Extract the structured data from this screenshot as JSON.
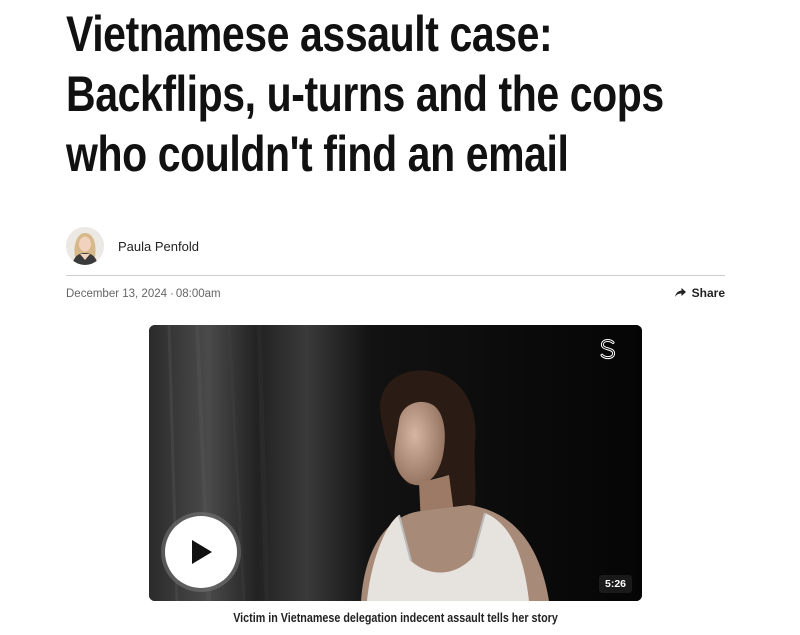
{
  "article": {
    "headline_lines": [
      "Vietnamese assault case:",
      "Backflips, u-turns and the cops",
      "who couldn't find an email"
    ],
    "author": {
      "name": "Paula Penfold",
      "avatar_icon": "author-avatar"
    },
    "date": "December 13, 2024",
    "separator": "·",
    "time": "08:00am",
    "share_label": "Share",
    "share_icon": "share-arrow-icon"
  },
  "video": {
    "brand_icon": "s-logo-icon",
    "play_icon": "play-icon",
    "duration": "5:26",
    "caption": "Victim in Vietnamese delegation indecent assault tells her story"
  },
  "colors": {
    "headline": "#111111",
    "meta_text": "#666666",
    "divider": "#cfcfcf",
    "video_bg": "#0a0a0a"
  }
}
